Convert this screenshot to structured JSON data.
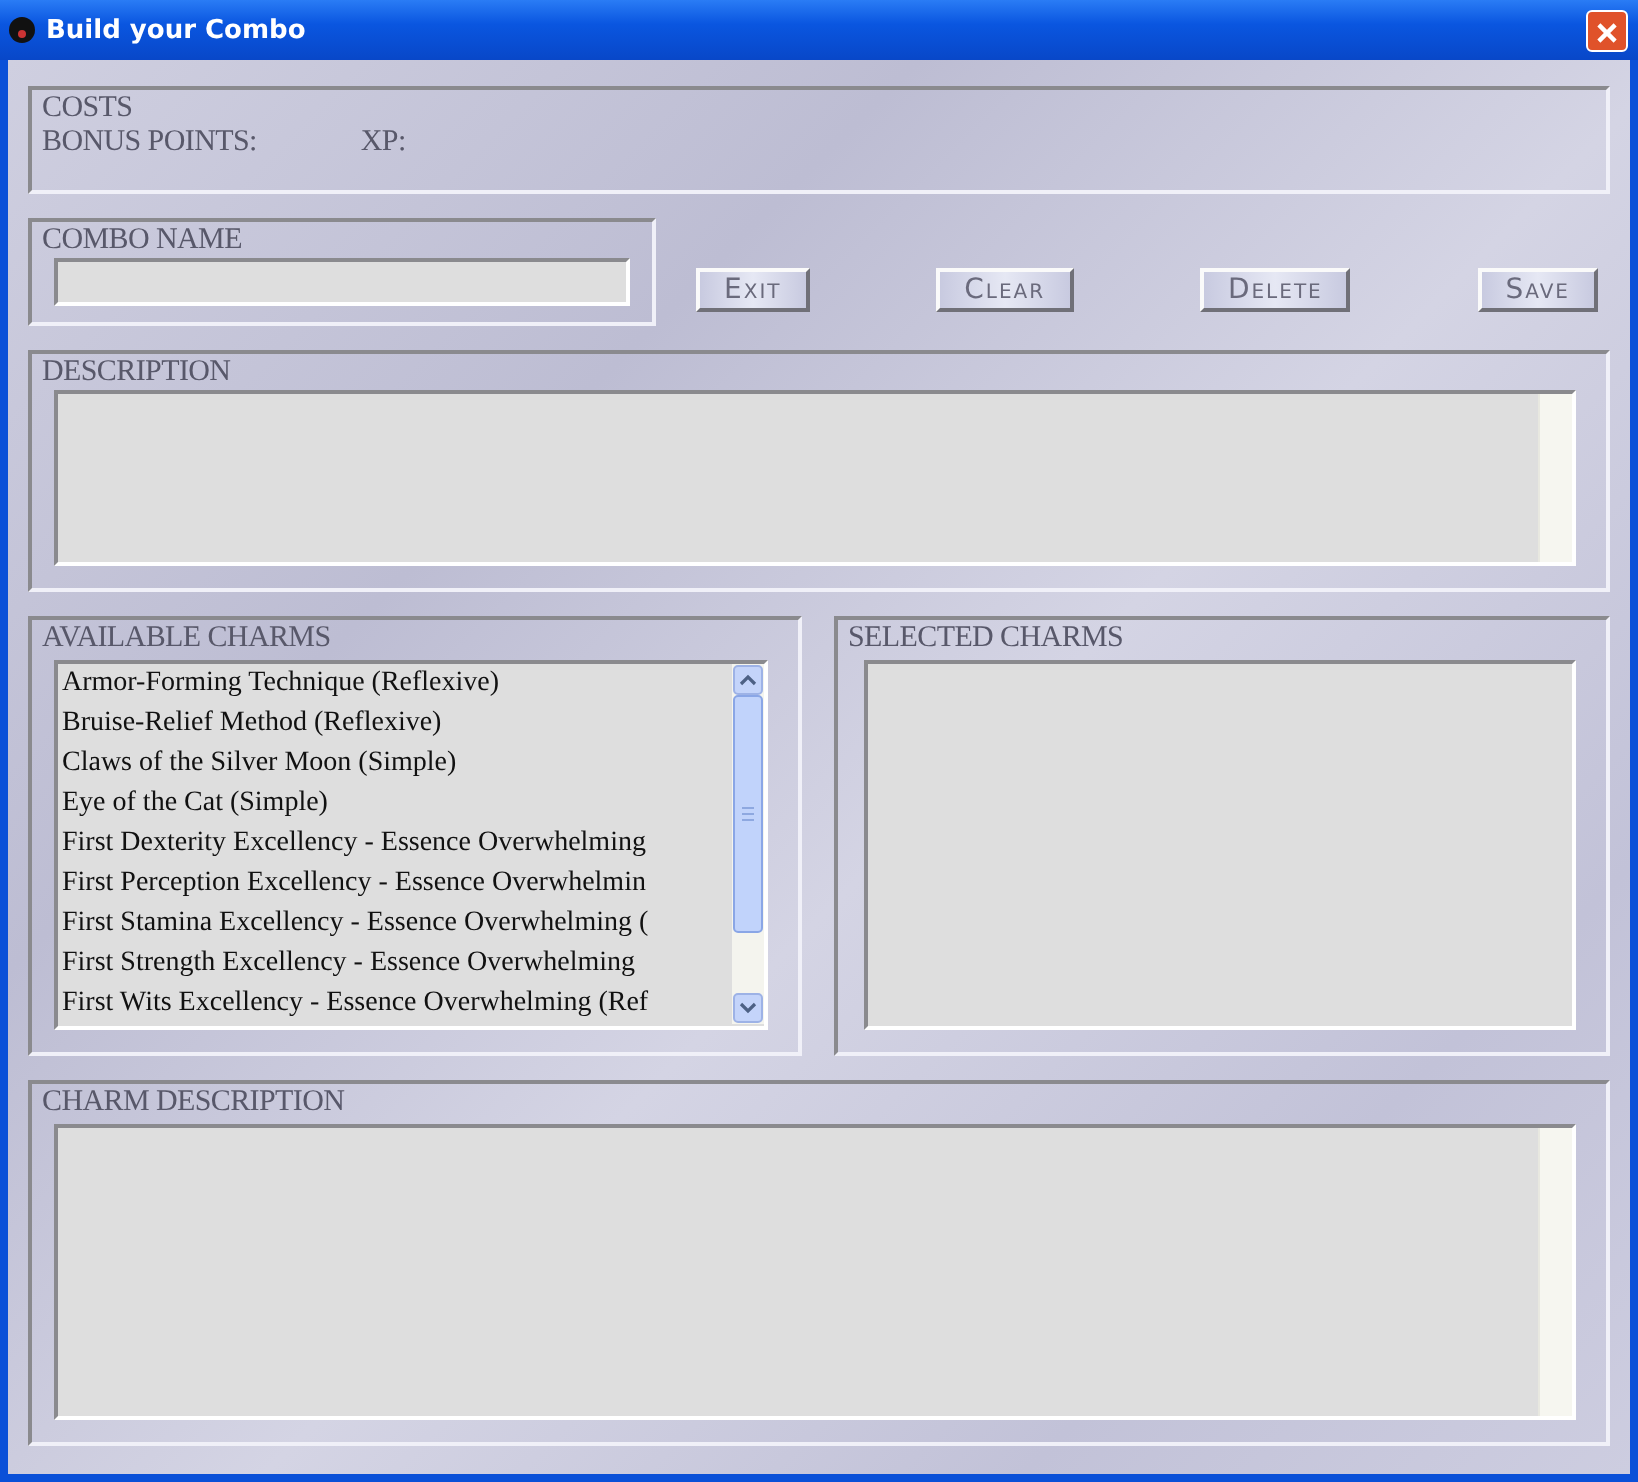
{
  "window": {
    "title": "Build your Combo"
  },
  "costs": {
    "heading": "COSTS",
    "bonus_points_label": "BONUS POINTS:",
    "xp_label": "XP:"
  },
  "combo_name": {
    "heading": "COMBO NAME"
  },
  "buttons": [
    "Exit",
    "Clear",
    "Delete",
    "Save"
  ],
  "description": {
    "heading": "DESCRIPTION"
  },
  "available_charms": {
    "heading": "AVAILABLE CHARMS",
    "items": [
      "Armor-Forming Technique (Reflexive)",
      "Bruise-Relief Method (Reflexive)",
      "Claws of the Silver Moon (Simple)",
      "Eye of the Cat (Simple)",
      "First Dexterity Excellency - Essence Overwhelming",
      "First Perception Excellency - Essence Overwhelmin",
      "First Stamina Excellency - Essence Overwhelming (",
      "First Strength Excellency - Essence Overwhelming",
      "First Wits Excellency - Essence Overwhelming (Ref"
    ]
  },
  "selected_charms": {
    "heading": "SELECTED CHARMS"
  },
  "charm_description": {
    "heading": "CHARM DESCRIPTION"
  }
}
